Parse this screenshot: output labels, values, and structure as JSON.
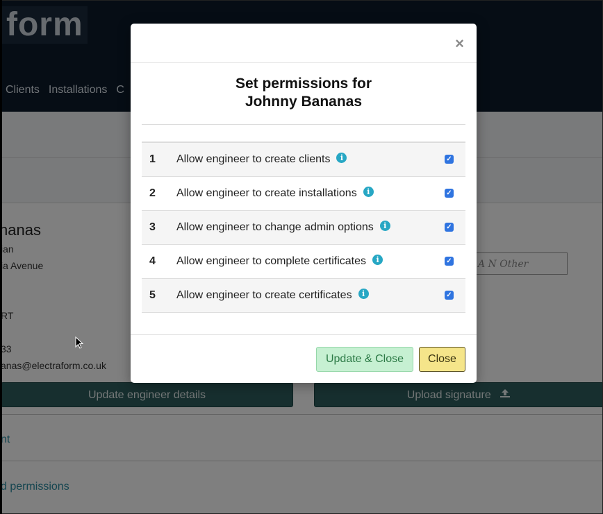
{
  "background": {
    "logo_text": "form",
    "nav": [
      "Clients",
      "Installations",
      "C"
    ],
    "engineer": {
      "name": "nanas",
      "line1": "ian",
      "line2": "ia Avenue",
      "line3": "RT",
      "line4": "33",
      "email": "anas@electraform.co.uk"
    },
    "signature_text": "A N Other",
    "update_details_button": "Update engineer details",
    "upload_signature_button": "Upload signature",
    "section_link_1": "nt",
    "section_link_2": "d permissions"
  },
  "modal": {
    "close_glyph": "×",
    "title_line1": "Set permissions for",
    "title_line2": "Johnny Bananas",
    "permissions": [
      {
        "num": "1",
        "label": "Allow engineer to create clients",
        "checked": true
      },
      {
        "num": "2",
        "label": "Allow engineer to create installations",
        "checked": true
      },
      {
        "num": "3",
        "label": "Allow engineer to change admin options",
        "checked": true
      },
      {
        "num": "4",
        "label": "Allow engineer to complete certificates",
        "checked": true
      },
      {
        "num": "5",
        "label": "Allow engineer to create certificates",
        "checked": true
      }
    ],
    "update_close_button": "Update & Close",
    "close_button": "Close"
  },
  "icons": {
    "info": "info-icon",
    "check": "checkbox-checked",
    "upload": "upload-icon"
  },
  "colors": {
    "header_bg": "#0d1b2a",
    "teal_button": "#2e5f5f",
    "info_icon": "#27a7c4",
    "checkbox": "#2f74e0",
    "update_button_bg": "#c6f0d2",
    "close_button_bg": "#f5e58a"
  }
}
